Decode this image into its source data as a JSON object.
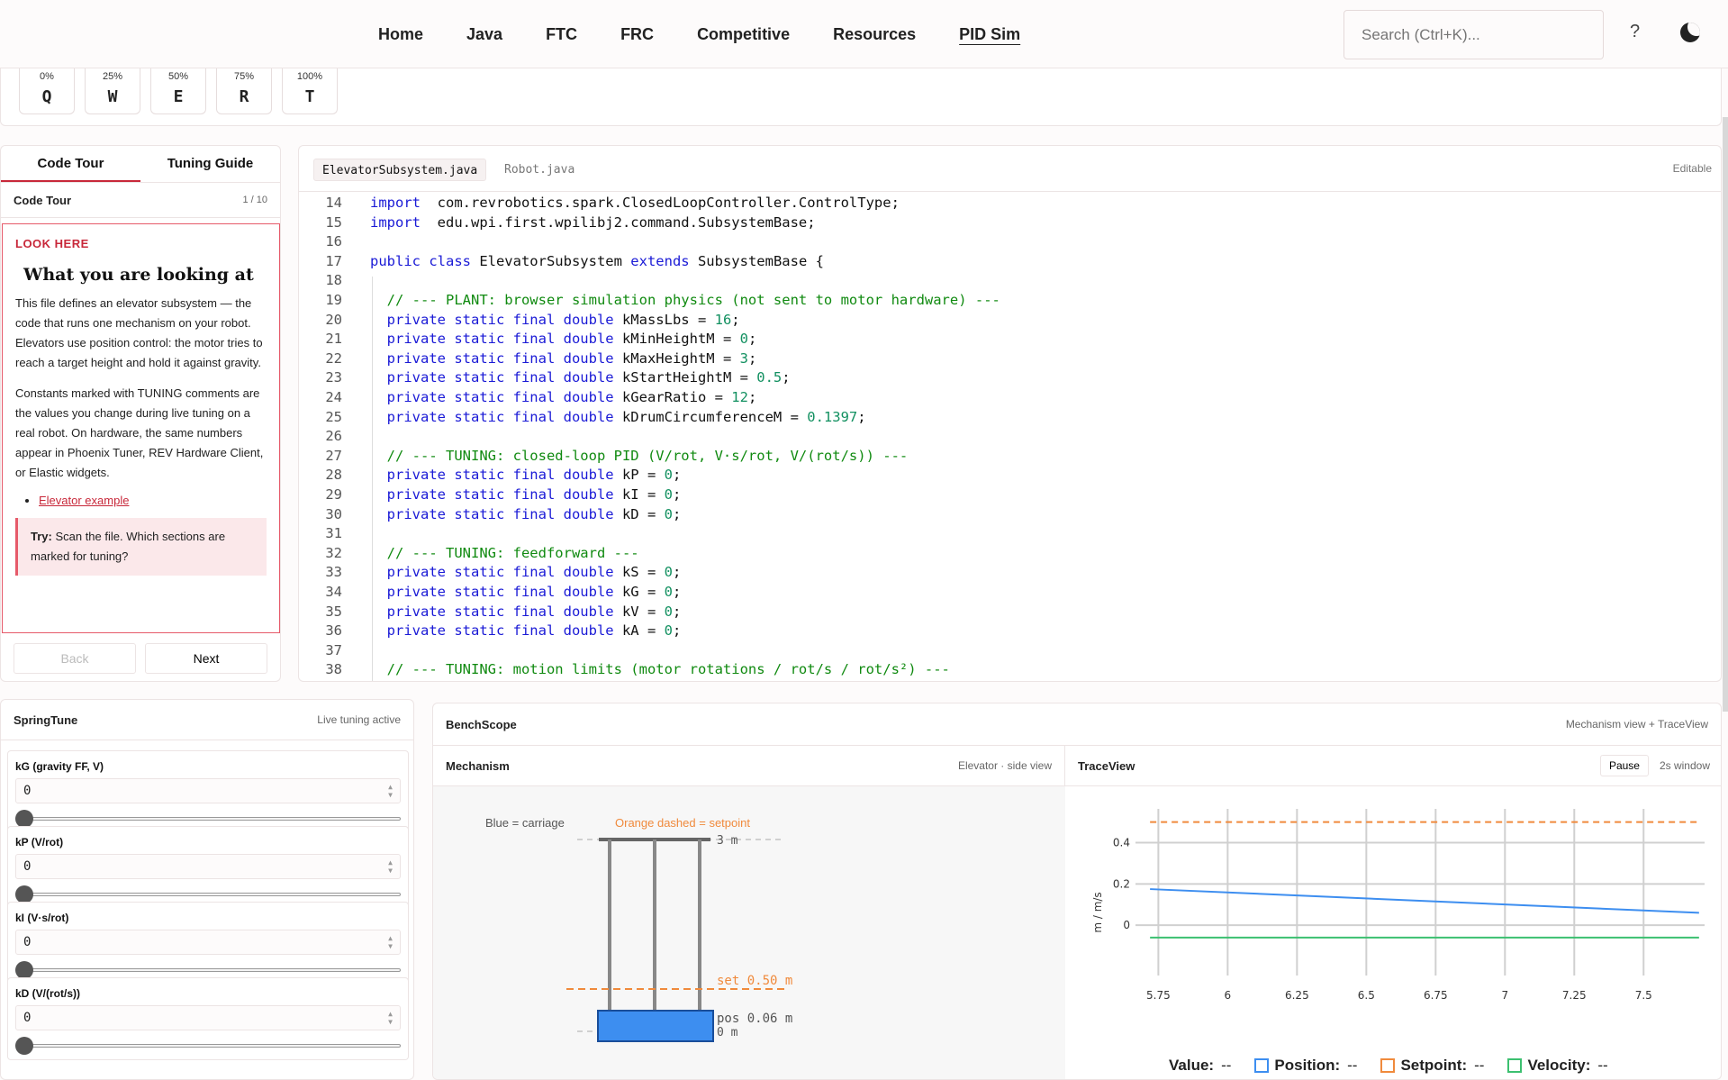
{
  "nav": {
    "links": [
      "Home",
      "Java",
      "FTC",
      "FRC",
      "Competitive",
      "Resources",
      "PID Sim"
    ],
    "active": "PID Sim",
    "search_placeholder": "Search (Ctrl+K)...",
    "help": "?"
  },
  "keys": [
    {
      "pct": "0%",
      "key": "Q"
    },
    {
      "pct": "25%",
      "key": "W"
    },
    {
      "pct": "50%",
      "key": "E"
    },
    {
      "pct": "75%",
      "key": "R"
    },
    {
      "pct": "100%",
      "key": "T"
    }
  ],
  "left": {
    "tabs": [
      "Code Tour",
      "Tuning Guide"
    ],
    "tour_title": "Code Tour",
    "tour_step": "1 / 10",
    "look_here": "LOOK HERE",
    "heading": "What you are looking at",
    "para1": "This file defines an elevator subsystem — the code that runs one mechanism on your robot. Elevators use position control: the motor tries to reach a target height and hold it against gravity.",
    "para2": "Constants marked with TUNING comments are the values you change during live tuning on a real robot. On hardware, the same numbers appear in Phoenix Tuner, REV Hardware Client, or Elastic widgets.",
    "link": "Elevator example",
    "try_label": "Try:",
    "try_text": " Scan the file. Which sections are marked for tuning?",
    "back": "Back",
    "next": "Next"
  },
  "editor": {
    "tabs": [
      "ElevatorSubsystem.java",
      "Robot.java"
    ],
    "status": "Editable",
    "lines": [
      {
        "n": "14",
        "seg": [
          [
            "kw",
            "import"
          ],
          [
            "",
            "  com.revrobotics.spark.ClosedLoopController.ControlType;"
          ]
        ]
      },
      {
        "n": "15",
        "seg": [
          [
            "kw",
            "import"
          ],
          [
            "",
            "  edu.wpi.first.wpilibj2.command.SubsystemBase;"
          ]
        ]
      },
      {
        "n": "16",
        "seg": []
      },
      {
        "n": "17",
        "seg": [
          [
            "kw",
            "public class"
          ],
          [
            "",
            " ElevatorSubsystem "
          ],
          [
            "kw",
            "extends"
          ],
          [
            "",
            " SubsystemBase {"
          ]
        ]
      },
      {
        "n": "18",
        "seg": []
      },
      {
        "n": "19",
        "seg": [
          [
            "cm",
            "  // --- PLANT: browser simulation physics (not sent to motor hardware) ---"
          ]
        ]
      },
      {
        "n": "20",
        "seg": [
          [
            "kw",
            "  private static final double"
          ],
          [
            "",
            " kMassLbs = "
          ],
          [
            "num",
            "16"
          ],
          [
            "",
            ";"
          ]
        ]
      },
      {
        "n": "21",
        "seg": [
          [
            "kw",
            "  private static final double"
          ],
          [
            "",
            " kMinHeightM = "
          ],
          [
            "num",
            "0"
          ],
          [
            "",
            ";"
          ]
        ]
      },
      {
        "n": "22",
        "seg": [
          [
            "kw",
            "  private static final double"
          ],
          [
            "",
            " kMaxHeightM = "
          ],
          [
            "num",
            "3"
          ],
          [
            "",
            ";"
          ]
        ]
      },
      {
        "n": "23",
        "seg": [
          [
            "kw",
            "  private static final double"
          ],
          [
            "",
            " kStartHeightM = "
          ],
          [
            "num",
            "0.5"
          ],
          [
            "",
            ";"
          ]
        ]
      },
      {
        "n": "24",
        "seg": [
          [
            "kw",
            "  private static final double"
          ],
          [
            "",
            " kGearRatio = "
          ],
          [
            "num",
            "12"
          ],
          [
            "",
            ";"
          ]
        ]
      },
      {
        "n": "25",
        "seg": [
          [
            "kw",
            "  private static final double"
          ],
          [
            "",
            " kDrumCircumferenceM = "
          ],
          [
            "num",
            "0.1397"
          ],
          [
            "",
            ";"
          ]
        ]
      },
      {
        "n": "26",
        "seg": []
      },
      {
        "n": "27",
        "seg": [
          [
            "cm",
            "  // --- TUNING: closed-loop PID (V/rot, V·s/rot, V/(rot/s)) ---"
          ]
        ]
      },
      {
        "n": "28",
        "seg": [
          [
            "kw",
            "  private static final double"
          ],
          [
            "",
            " kP = "
          ],
          [
            "num",
            "0"
          ],
          [
            "",
            ";"
          ]
        ]
      },
      {
        "n": "29",
        "seg": [
          [
            "kw",
            "  private static final double"
          ],
          [
            "",
            " kI = "
          ],
          [
            "num",
            "0"
          ],
          [
            "",
            ";"
          ]
        ]
      },
      {
        "n": "30",
        "seg": [
          [
            "kw",
            "  private static final double"
          ],
          [
            "",
            " kD = "
          ],
          [
            "num",
            "0"
          ],
          [
            "",
            ";"
          ]
        ]
      },
      {
        "n": "31",
        "seg": []
      },
      {
        "n": "32",
        "seg": [
          [
            "cm",
            "  // --- TUNING: feedforward ---"
          ]
        ]
      },
      {
        "n": "33",
        "seg": [
          [
            "kw",
            "  private static final double"
          ],
          [
            "",
            " kS = "
          ],
          [
            "num",
            "0"
          ],
          [
            "",
            ";"
          ]
        ]
      },
      {
        "n": "34",
        "seg": [
          [
            "kw",
            "  private static final double"
          ],
          [
            "",
            " kG = "
          ],
          [
            "num",
            "0"
          ],
          [
            "",
            ";"
          ]
        ]
      },
      {
        "n": "35",
        "seg": [
          [
            "kw",
            "  private static final double"
          ],
          [
            "",
            " kV = "
          ],
          [
            "num",
            "0"
          ],
          [
            "",
            ";"
          ]
        ]
      },
      {
        "n": "36",
        "seg": [
          [
            "kw",
            "  private static final double"
          ],
          [
            "",
            " kA = "
          ],
          [
            "num",
            "0"
          ],
          [
            "",
            ";"
          ]
        ]
      },
      {
        "n": "37",
        "seg": []
      },
      {
        "n": "38",
        "seg": [
          [
            "cm",
            "  // --- TUNING: motion limits (motor rotations / rot/s / rot/s²) ---"
          ]
        ]
      }
    ]
  },
  "spring": {
    "title": "SpringTune",
    "status": "Live tuning active",
    "params": [
      {
        "label": "kG (gravity FF, V)",
        "value": "0"
      },
      {
        "label": "kP (V/rot)",
        "value": "0"
      },
      {
        "label": "kI (V·s/rot)",
        "value": "0"
      },
      {
        "label": "kD (V/(rot/s))",
        "value": "0"
      }
    ]
  },
  "bench": {
    "title": "BenchScope",
    "subtitle": "Mechanism view + TraceView",
    "mech_title": "Mechanism",
    "mech_sub": "Elevator · side view",
    "blue_label": "Blue = carriage",
    "orange_label": "Orange dashed = setpoint",
    "top_label": "3 m",
    "bottom_label": "0 m",
    "set_label": "set 0.50 m",
    "pos_label": "pos 0.06 m",
    "trace_title": "TraceView",
    "pause": "Pause",
    "window": "2s window",
    "ylabel": "m / m/s",
    "legend": {
      "value_label": "Value:",
      "value": "--",
      "position_label": "Position:",
      "position": "--",
      "setpoint_label": "Setpoint:",
      "setpoint": "--",
      "velocity_label": "Velocity:",
      "velocity": "--"
    },
    "colors": {
      "carriage": "#3d8ef0",
      "setpoint": "#f08a3c",
      "velocity": "#3cc070"
    }
  },
  "chart_data": {
    "type": "line",
    "xlabel": "",
    "ylabel": "m / m/s",
    "xlim": [
      5.7,
      7.72
    ],
    "ylim": [
      -0.2,
      0.52
    ],
    "x_ticks": [
      5.75,
      6,
      6.25,
      6.5,
      6.75,
      7,
      7.25,
      7.5
    ],
    "y_ticks": [
      0,
      0.2,
      0.4
    ],
    "series": [
      {
        "name": "Position",
        "color": "#3d8ef0",
        "style": "solid",
        "x": [
          5.72,
          7.7
        ],
        "y": [
          0.175,
          0.06
        ]
      },
      {
        "name": "Setpoint",
        "color": "#f08a3c",
        "style": "dashed",
        "x": [
          5.72,
          7.7
        ],
        "y": [
          0.5,
          0.5
        ]
      },
      {
        "name": "Velocity",
        "color": "#3cc070",
        "style": "solid",
        "x": [
          5.72,
          7.7
        ],
        "y": [
          -0.06,
          -0.06
        ]
      }
    ],
    "grid": true
  }
}
